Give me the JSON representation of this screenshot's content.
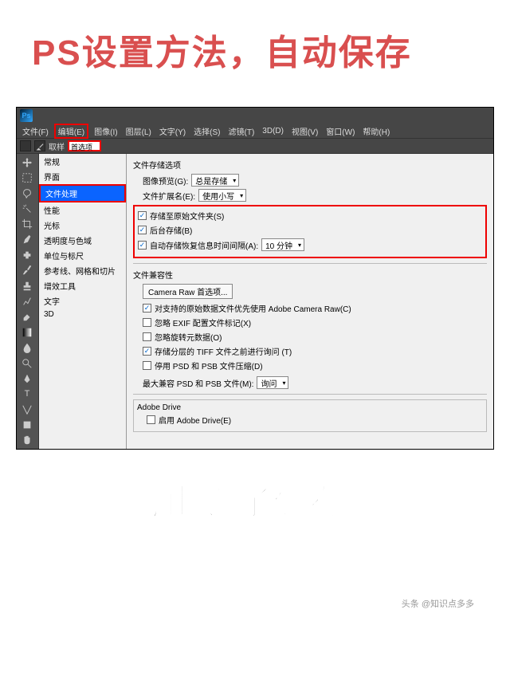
{
  "title_top": "PS设置方法，自动保存",
  "title_bottom": "防止忘了保存哟",
  "watermark": "头条 @知识点多多",
  "menubar": {
    "logo": "Ps",
    "items": [
      "文件(F)",
      "编辑(E)",
      "图像(I)",
      "图层(L)",
      "文字(Y)",
      "选择(S)",
      "滤镜(T)",
      "3D(D)",
      "视图(V)",
      "窗口(W)",
      "帮助(H)"
    ],
    "highlighted_index": 1
  },
  "optbar": {
    "label": "取样",
    "input": "首选项"
  },
  "dropdown": {
    "items": [
      "常规",
      "界面",
      "文件处理",
      "性能",
      "光标",
      "透明度与色域",
      "单位与标尺",
      "参考线、网格和切片",
      "增效工具",
      "文字",
      "3D"
    ],
    "selected_index": 2
  },
  "prefs": {
    "section1_title": "文件存储选项",
    "row1_label": "图像预览(G):",
    "row1_value": "总是存储",
    "row2_label": "文件扩展名(E):",
    "row2_value": "使用小写",
    "redbox": {
      "cb1": "存储至原始文件夹(S)",
      "cb2": "后台存储(B)",
      "cb3": "自动存储恢复信息时间间隔(A):",
      "cb3_value": "10 分钟"
    },
    "section2_title": "文件兼容性",
    "btn_camera": "Camera Raw 首选项...",
    "cb_a": "对支持的原始数据文件优先使用 Adobe Camera Raw(C)",
    "cb_b": "忽略 EXIF 配置文件标记(X)",
    "cb_c": "忽略旋转元数据(O)",
    "cb_d": "存储分层的 TIFF 文件之前进行询问 (T)",
    "cb_e": "停用 PSD 和 PSB 文件压缩(D)",
    "compat_label": "最大兼容 PSD 和 PSB 文件(M):",
    "compat_value": "询问",
    "adobe_drive_title": "Adobe Drive",
    "adobe_drive_cb": "启用 Adobe Drive(E)"
  }
}
